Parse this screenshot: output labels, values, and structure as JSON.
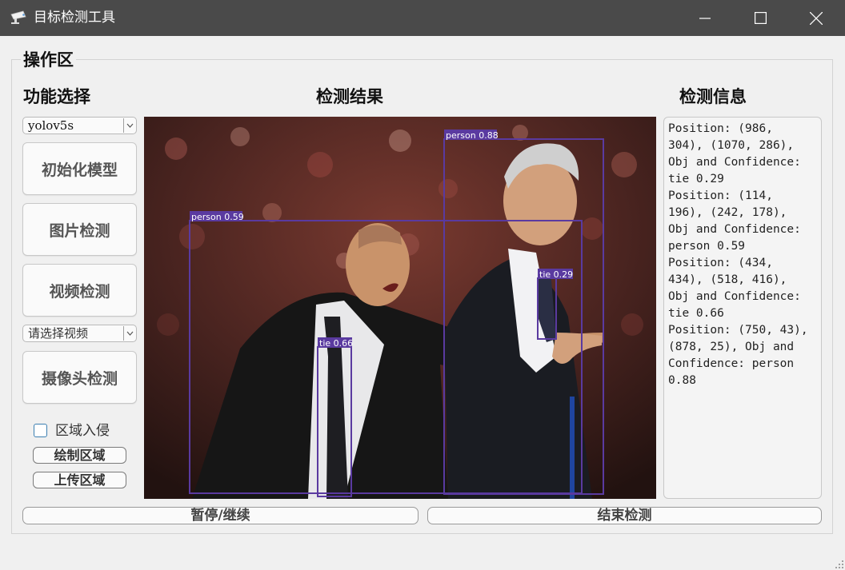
{
  "window": {
    "title": "目标检测工具",
    "icon": "cctv-camera-icon",
    "controls": [
      "minimize-icon",
      "maximize-icon",
      "close-icon"
    ]
  },
  "group": {
    "title": "操作区"
  },
  "labels": {
    "function_select": "功能选择",
    "detect_result": "检测结果",
    "detect_info": "检测信息"
  },
  "sidebar": {
    "model_select": "yolov5s",
    "init_model": "初始化模型",
    "image_detect": "图片检测",
    "video_detect": "视频检测",
    "video_select": "请选择视频",
    "camera_detect": "摄像头检测",
    "intrusion_checkbox": {
      "label": "区域入侵",
      "checked": false
    },
    "draw_area": "绘制区域",
    "upload_area": "上传区域"
  },
  "detections": [
    {
      "label": "person 0.88",
      "class": "person",
      "confidence": 0.88
    },
    {
      "label": "person 0.59",
      "class": "person",
      "confidence": 0.59
    },
    {
      "label": "tie 0.29",
      "class": "tie",
      "confidence": 0.29
    },
    {
      "label": "tie 0.66",
      "class": "tie",
      "confidence": 0.66
    }
  ],
  "colors": {
    "box": "#5a3aa0",
    "titlebar": "#4a4a4a"
  },
  "info": {
    "lines": [
      "Position: (986,",
      "304), (1070, 286),",
      "Obj and Confidence:",
      "tie 0.29",
      "Position: (114,",
      "196), (242, 178),",
      "Obj and Confidence:",
      "person 0.59",
      "Position: (434,",
      "434), (518, 416),",
      "Obj and Confidence:",
      "tie 0.66",
      "Position: (750, 43),",
      "(878, 25), Obj and",
      "Confidence: person",
      "0.88"
    ]
  },
  "bottom": {
    "pause_resume": "暂停/继续",
    "stop_detect": "结束检测"
  }
}
